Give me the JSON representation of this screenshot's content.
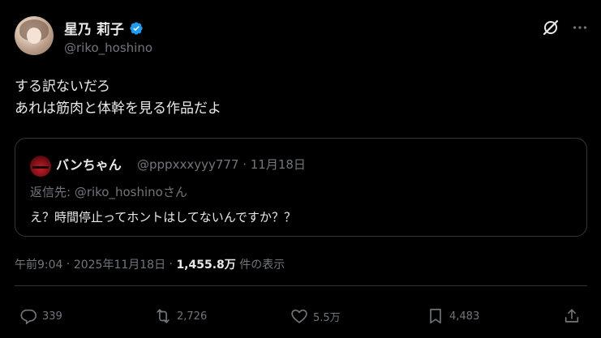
{
  "author": {
    "display_name": "星乃 莉子",
    "handle": "@riko_hoshino"
  },
  "tweet": {
    "lines": [
      "する訳ないだろ",
      "あれは筋肉と体幹を見る作品だよ"
    ]
  },
  "quote": {
    "display_name": "バンちゃん",
    "handle_date": "@pppxxxyyy777 · 11月18日",
    "reply_to": "返信先: @riko_hoshinoさん",
    "text": "え？時間停止ってホントはしてないんですか？？"
  },
  "meta": {
    "time": "午前9:04",
    "sep1": " · ",
    "date": "2025年11月18日",
    "sep2": " · ",
    "views": "1,455.8万",
    "views_label": " 件の表示"
  },
  "actions": {
    "replies": "339",
    "reposts": "2,726",
    "likes": "5.5万",
    "bookmarks": "4,483"
  },
  "colors": {
    "background": "#000000",
    "text": "#e7e9ea",
    "secondary": "#71767b",
    "verified": "#1d9bf0"
  }
}
